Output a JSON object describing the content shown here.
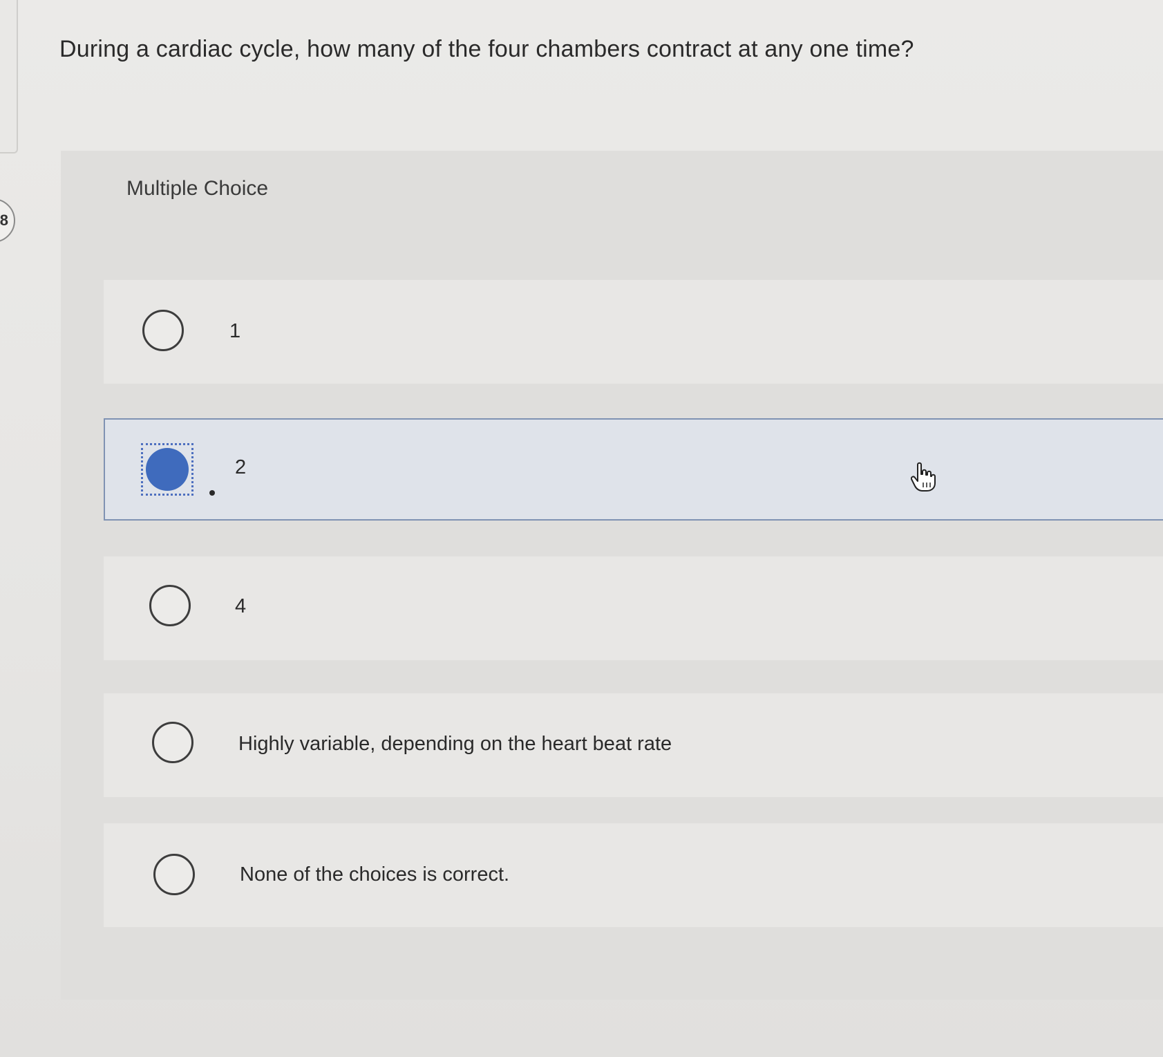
{
  "question": {
    "number": "8",
    "text": "During a cardiac cycle, how many of the four chambers contract at any one time?"
  },
  "panel": {
    "label": "Multiple Choice"
  },
  "choices": [
    {
      "label": "1",
      "selected": false
    },
    {
      "label": "2",
      "selected": true
    },
    {
      "label": "4",
      "selected": false
    },
    {
      "label": "Highly variable, depending on the heart beat rate",
      "selected": false
    },
    {
      "label": "None of the choices is correct.",
      "selected": false
    }
  ],
  "colors": {
    "selected_fill": "#3f6bbd",
    "selected_border": "#7f92b3"
  },
  "icons": {
    "cursor": "hand-pointer-icon"
  }
}
